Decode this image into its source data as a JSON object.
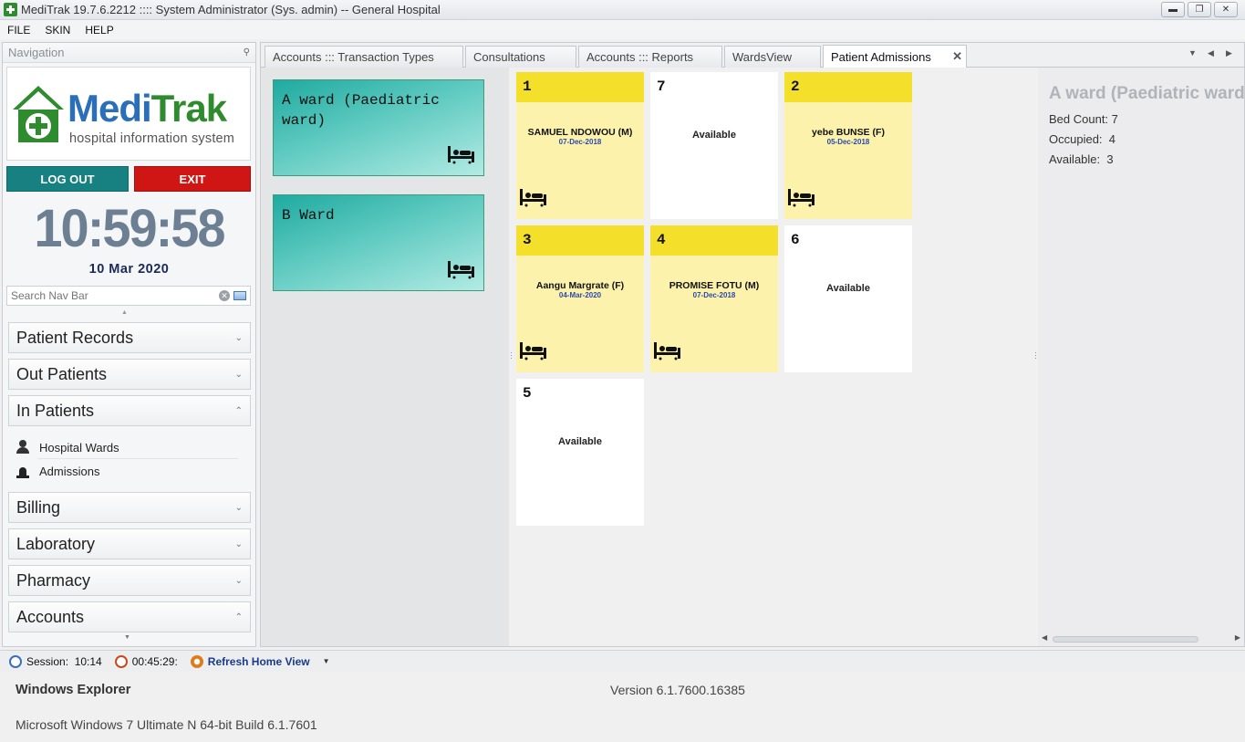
{
  "window": {
    "title": "MediTrak 19.7.6.2212 ::::  System Administrator (Sys. admin) -- General Hospital",
    "controls": [
      "minimize",
      "restore",
      "close"
    ]
  },
  "menu": [
    "FILE",
    "SKIN",
    "HELP"
  ],
  "nav": {
    "header": "Navigation",
    "logo": {
      "medi": "Medi",
      "trak": "Trak",
      "tagline": "hospital information system"
    },
    "logout_label": "LOG OUT",
    "exit_label": "EXIT",
    "clock": "10:59:58",
    "date": "10 Mar 2020",
    "search_placeholder": "Search Nav Bar",
    "groups": {
      "patient_records": "Patient Records",
      "out_patients": "Out Patients",
      "in_patients": "In Patients",
      "billing": "Billing",
      "laboratory": "Laboratory",
      "pharmacy": "Pharmacy",
      "accounts": "Accounts"
    },
    "in_patients_items": [
      "Hospital Wards",
      "Admissions"
    ]
  },
  "tabs": [
    "Accounts ::: Transaction Types",
    "Consultations",
    "Accounts ::: Reports",
    "WardsView",
    "Patient Admissions"
  ],
  "active_tab": "Patient Admissions",
  "wards": [
    "A ward (Paediatric ward)",
    "B Ward"
  ],
  "beds": [
    {
      "number": "1",
      "status": "occupied",
      "patient": "SAMUEL NDOWOU (M)",
      "date": "07-Dec-2018"
    },
    {
      "number": "7",
      "status": "available",
      "label": "Available"
    },
    {
      "number": "2",
      "status": "occupied",
      "patient": "yebe BUNSE (F)",
      "date": "05-Dec-2018"
    },
    {
      "number": "3",
      "status": "occupied",
      "patient": "Aangu Margrate (F)",
      "date": "04-Mar-2020"
    },
    {
      "number": "4",
      "status": "occupied",
      "patient": "PROMISE FOTU (M)",
      "date": "07-Dec-2018"
    },
    {
      "number": "6",
      "status": "available",
      "label": "Available"
    },
    {
      "number": "5",
      "status": "available",
      "label": "Available"
    }
  ],
  "ward_info": {
    "title": "A ward (Paediatric ward)",
    "bed_count_label": "Bed Count:",
    "bed_count": "7",
    "occupied_label": "Occupied:",
    "occupied": "4",
    "available_label": "Available:",
    "available": "3"
  },
  "status": {
    "session_label": "Session:",
    "session_value": "10:14",
    "timer": "00:45:29:",
    "refresh_label": "Refresh Home View"
  },
  "footer": {
    "app": "Windows Explorer",
    "version": "Version 6.1.7600.16385",
    "os": "Microsoft Windows 7 Ultimate N  64-bit Build 6.1.7601"
  },
  "colors": {
    "logout": "#178080",
    "exit": "#d01515",
    "bed_occupied_head": "#f4e02a",
    "bed_occupied_body": "#fdf2ac",
    "ward_card": "#26b3a8"
  }
}
